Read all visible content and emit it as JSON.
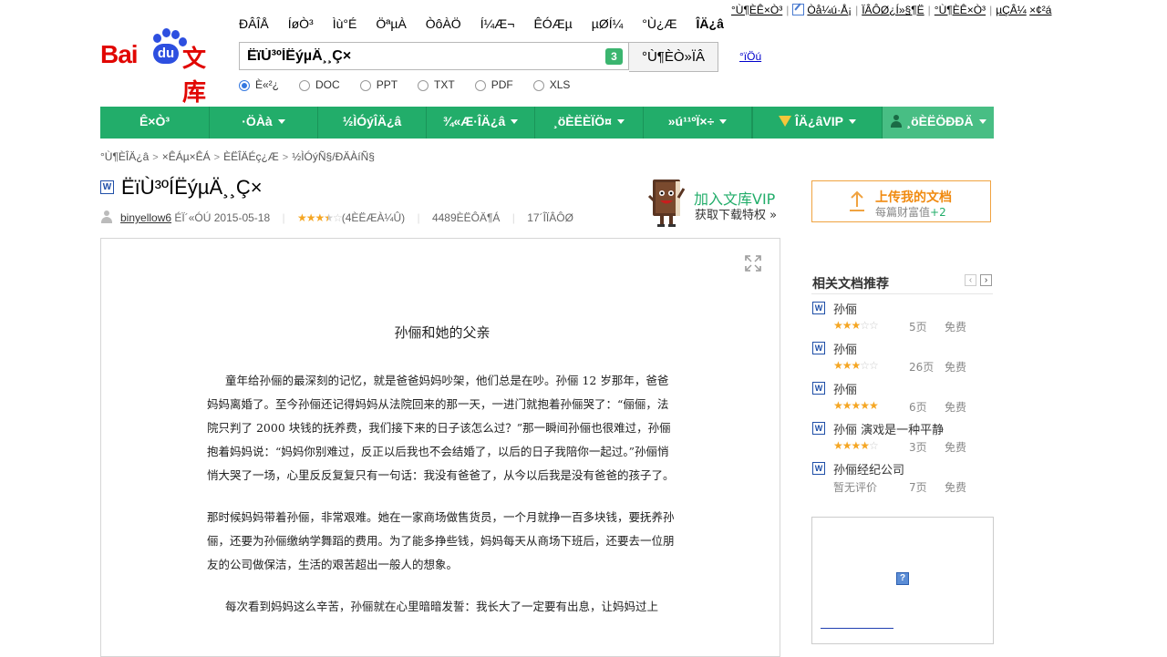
{
  "top_links": [
    "°Ù¶ÈÊ×Ò³",
    "Òå¼ú·Å¡",
    "ÏÂÔØ¿Í»§¶Ë",
    "°Ù¶ÈÊ×Ò³",
    "µÇÂ¼",
    "×¢²á"
  ],
  "logo_alt": "Baidu 文库",
  "search_tabs": [
    "ÐÂÎÅ",
    "ÍøÒ³",
    "Ìù°É",
    "ÖªµÀ",
    "ÒôÀÖ",
    "Í¼Æ¬",
    "ÊÓÆµ",
    "µØÍ¼",
    "°Ù¿Æ",
    "ÎÄ¿â"
  ],
  "search_active_index": 9,
  "search_value": "ËïÙ³ºÍËýµÄ¸¸Ç×",
  "search_count_badge": "3",
  "search_button_label": "°Ù¶ÈÒ»ÏÂ",
  "advanced_link": "°ïÖú",
  "filters": [
    {
      "label": "È«²¿",
      "checked": true
    },
    {
      "label": "DOC",
      "checked": false
    },
    {
      "label": "PPT",
      "checked": false
    },
    {
      "label": "TXT",
      "checked": false
    },
    {
      "label": "PDF",
      "checked": false
    },
    {
      "label": "XLS",
      "checked": false
    }
  ],
  "nav": [
    {
      "label": "Ê×Ò³",
      "caret": false
    },
    {
      "label": "·ÖÀà",
      "caret": true
    },
    {
      "label": "½ÌÓýÎÄ¿â",
      "caret": false
    },
    {
      "label": "¾«Æ·ÎÄ¿â",
      "caret": true
    },
    {
      "label": "¸öÈËÈÏÖ¤",
      "caret": true
    },
    {
      "label": "»ú¹¹ºÏ×÷",
      "caret": true
    },
    {
      "label": "ÎÄ¿âVIP",
      "caret": true,
      "icon": "vip-icon"
    },
    {
      "label": "¸öÈËÖÐÐÄ",
      "caret": true,
      "icon": "user-icon"
    }
  ],
  "breadcrumb": [
    "°Ù¶ÈÎÄ¿â",
    "×ÊÁµ×ÊÁ",
    "ÈËÎÄÉç¿Æ",
    "½ÌÓýÑ§/ÐÄÀíÑ§"
  ],
  "doc": {
    "type_icon": "W",
    "title": "ËïÙ³ºÍËýµÄ¸¸Ç×",
    "author": "binyellow6",
    "share_label": "ÉÏ´«ÓÚ",
    "date": "2015-05-18",
    "rating": 3.5,
    "rating_label": "(4ÈËÆÀ¼Û)",
    "reads": "4489ÈËÔÄ¶Á",
    "downloads": "17´ÎÏÂÔØ",
    "content_title": "孙俪和她的父亲",
    "paragraphs": [
      {
        "indent": true,
        "text": "童年给孙俪的最深刻的记忆，就是爸爸妈妈吵架，他们总是在吵。孙俪 12 岁那年，爸爸妈妈离婚了。至今孙俪还记得妈妈从法院回来的那一天，一进门就抱着孙俪哭了：“俪俪，法院只判了 2000 块钱的抚养费，我们接下来的日子该怎么过？”那一瞬间孙俪也很难过，孙俪抱着妈妈说：“妈妈你别难过，反正以后我也不会结婚了，以后的日子我陪你一起过。”孙俪悄悄大哭了一场，心里反反复复只有一句话：我没有爸爸了，从今以后我是没有爸爸的孩子了。"
      },
      {
        "indent": false,
        "text": "那时候妈妈带着孙俪，非常艰难。她在一家商场做售货员，一个月就挣一百多块钱，要抚养孙俪，还要为孙俪缴纳学舞蹈的费用。为了能多挣些钱，妈妈每天从商场下班后，还要去一位朋友的公司做保洁，生活的艰苦超出一般人的想象。"
      },
      {
        "indent": true,
        "text": "每次看到妈妈这么辛苦，孙俪就在心里暗暗发誓：我长大了一定要有出息，让妈妈过上"
      }
    ]
  },
  "vip_promo": {
    "line1": "加入文库VIP",
    "line2": "获取下载特权 »"
  },
  "upload": {
    "title": "上传我的文档",
    "sub_prefix": "每篇财富值",
    "sub_value": "+2"
  },
  "related": {
    "heading": "相关文档推荐",
    "prev": "‹",
    "next": "›",
    "items": [
      {
        "name": "孙俪",
        "rating": 3,
        "pages": "5页",
        "price": "免费"
      },
      {
        "name": "孙俪",
        "rating": 3,
        "pages": "26页",
        "price": "免费"
      },
      {
        "name": "孙俪",
        "rating": 5,
        "pages": "6页",
        "price": "免费"
      },
      {
        "name": "孙俪 演戏是一种平静",
        "rating": 4,
        "pages": "3页",
        "price": "免费"
      },
      {
        "name": "孙俪经纪公司",
        "rating": null,
        "no_rating_label": "暂无评价",
        "pages": "7页",
        "price": "免费"
      }
    ]
  },
  "ad_placeholder": "?",
  "colors": {
    "brand_green": "#22ad6a",
    "brand_red": "#e10602",
    "baidu_blue": "#2d4fe0",
    "star": "#f5a623",
    "upload_orange": "#f08a10"
  }
}
